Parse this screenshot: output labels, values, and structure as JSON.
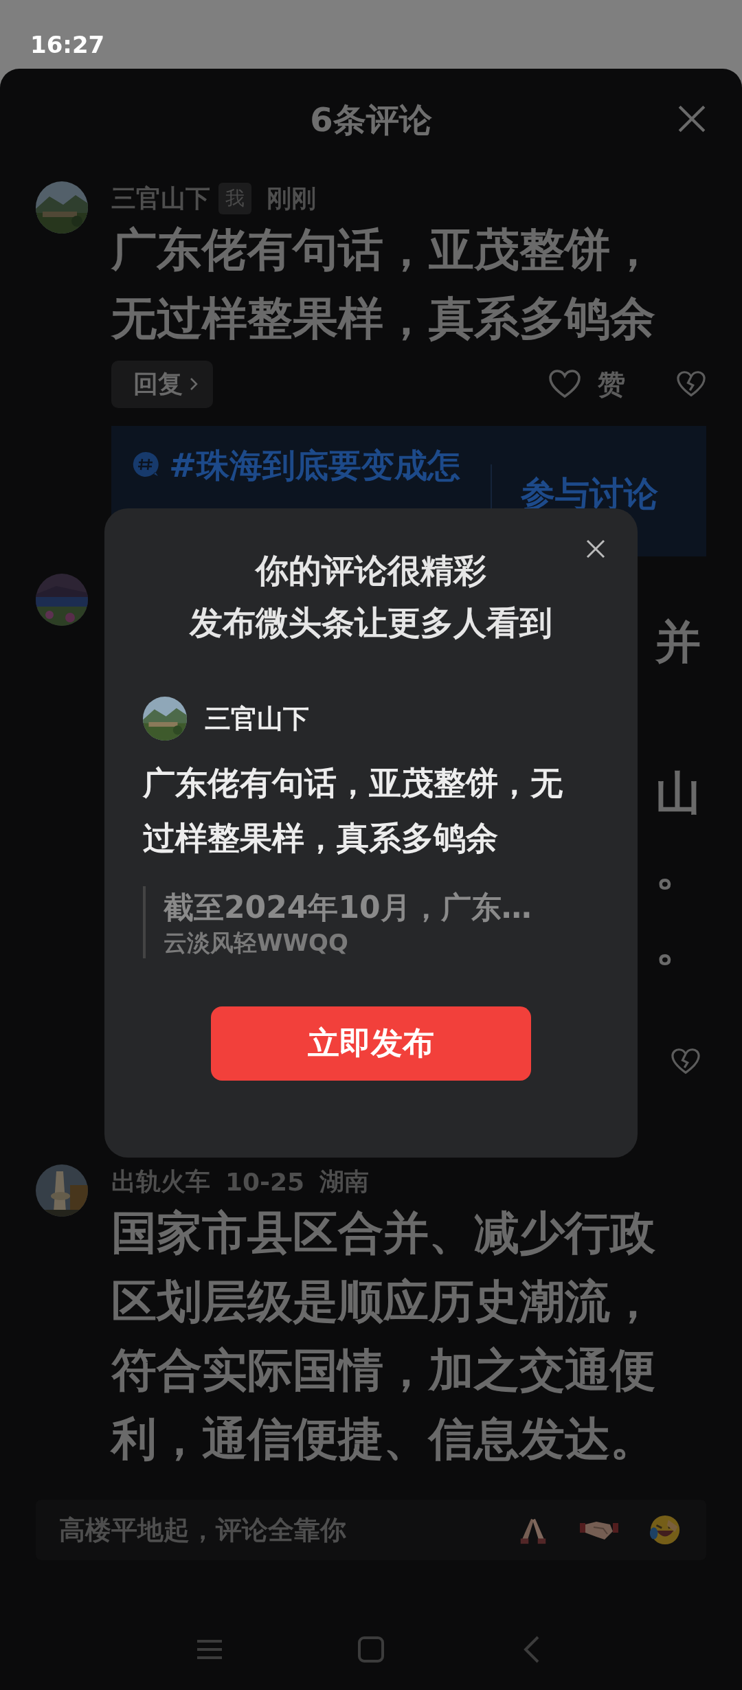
{
  "status_bar": {
    "time": "16:27"
  },
  "sheet": {
    "title": "6条评论"
  },
  "comments": [
    {
      "author": "三官山下",
      "badge": "我",
      "meta": [
        "刚刚"
      ],
      "text": "广东佬有句话，亚茂整饼，无过样整果样，真系多鸲余",
      "reply": "回复",
      "like": "赞",
      "topic": {
        "title": "#珠海到底要变成怎",
        "action": "参与讨论"
      }
    },
    {
      "fragments": [
        "并",
        "山",
        "。",
        "。"
      ]
    },
    {
      "author": "出轨火车",
      "meta": [
        "10-25",
        "湖南"
      ],
      "text": "国家市县区合并、减少行政区划层级是顺应历史潮流，符合实际国情，加之交通便利，通信便捷、信息发达。"
    }
  ],
  "composer": {
    "placeholder": "高楼平地起，评论全靠你"
  },
  "dialog": {
    "title_lines": [
      "你的评论很精彩",
      "发布微头条让更多人看到"
    ],
    "author": "三官山下",
    "text": "广东佬有句话，亚茂整饼，无过样整果样，真系多鸲余",
    "quote": "截至2024年10月，广东…",
    "quote_author": "云淡风轻WWQQ",
    "button": "立即发布"
  }
}
